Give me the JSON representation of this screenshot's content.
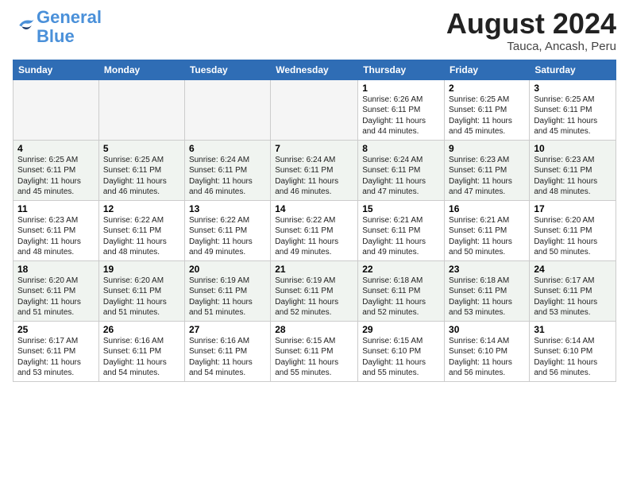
{
  "logo": {
    "line1": "General",
    "line2": "Blue"
  },
  "title": "August 2024",
  "subtitle": "Tauca, Ancash, Peru",
  "days_of_week": [
    "Sunday",
    "Monday",
    "Tuesday",
    "Wednesday",
    "Thursday",
    "Friday",
    "Saturday"
  ],
  "weeks": [
    {
      "cells": [
        {
          "empty": true
        },
        {
          "empty": true
        },
        {
          "empty": true
        },
        {
          "empty": true
        },
        {
          "day": "1",
          "sunrise": "6:26 AM",
          "sunset": "6:11 PM",
          "daylight": "11 hours and 44 minutes."
        },
        {
          "day": "2",
          "sunrise": "6:25 AM",
          "sunset": "6:11 PM",
          "daylight": "11 hours and 45 minutes."
        },
        {
          "day": "3",
          "sunrise": "6:25 AM",
          "sunset": "6:11 PM",
          "daylight": "11 hours and 45 minutes."
        }
      ]
    },
    {
      "cells": [
        {
          "day": "4",
          "sunrise": "6:25 AM",
          "sunset": "6:11 PM",
          "daylight": "11 hours and 45 minutes."
        },
        {
          "day": "5",
          "sunrise": "6:25 AM",
          "sunset": "6:11 PM",
          "daylight": "11 hours and 46 minutes."
        },
        {
          "day": "6",
          "sunrise": "6:24 AM",
          "sunset": "6:11 PM",
          "daylight": "11 hours and 46 minutes."
        },
        {
          "day": "7",
          "sunrise": "6:24 AM",
          "sunset": "6:11 PM",
          "daylight": "11 hours and 46 minutes."
        },
        {
          "day": "8",
          "sunrise": "6:24 AM",
          "sunset": "6:11 PM",
          "daylight": "11 hours and 47 minutes."
        },
        {
          "day": "9",
          "sunrise": "6:23 AM",
          "sunset": "6:11 PM",
          "daylight": "11 hours and 47 minutes."
        },
        {
          "day": "10",
          "sunrise": "6:23 AM",
          "sunset": "6:11 PM",
          "daylight": "11 hours and 48 minutes."
        }
      ]
    },
    {
      "cells": [
        {
          "day": "11",
          "sunrise": "6:23 AM",
          "sunset": "6:11 PM",
          "daylight": "11 hours and 48 minutes."
        },
        {
          "day": "12",
          "sunrise": "6:22 AM",
          "sunset": "6:11 PM",
          "daylight": "11 hours and 48 minutes."
        },
        {
          "day": "13",
          "sunrise": "6:22 AM",
          "sunset": "6:11 PM",
          "daylight": "11 hours and 49 minutes."
        },
        {
          "day": "14",
          "sunrise": "6:22 AM",
          "sunset": "6:11 PM",
          "daylight": "11 hours and 49 minutes."
        },
        {
          "day": "15",
          "sunrise": "6:21 AM",
          "sunset": "6:11 PM",
          "daylight": "11 hours and 49 minutes."
        },
        {
          "day": "16",
          "sunrise": "6:21 AM",
          "sunset": "6:11 PM",
          "daylight": "11 hours and 50 minutes."
        },
        {
          "day": "17",
          "sunrise": "6:20 AM",
          "sunset": "6:11 PM",
          "daylight": "11 hours and 50 minutes."
        }
      ]
    },
    {
      "cells": [
        {
          "day": "18",
          "sunrise": "6:20 AM",
          "sunset": "6:11 PM",
          "daylight": "11 hours and 51 minutes."
        },
        {
          "day": "19",
          "sunrise": "6:20 AM",
          "sunset": "6:11 PM",
          "daylight": "11 hours and 51 minutes."
        },
        {
          "day": "20",
          "sunrise": "6:19 AM",
          "sunset": "6:11 PM",
          "daylight": "11 hours and 51 minutes."
        },
        {
          "day": "21",
          "sunrise": "6:19 AM",
          "sunset": "6:11 PM",
          "daylight": "11 hours and 52 minutes."
        },
        {
          "day": "22",
          "sunrise": "6:18 AM",
          "sunset": "6:11 PM",
          "daylight": "11 hours and 52 minutes."
        },
        {
          "day": "23",
          "sunrise": "6:18 AM",
          "sunset": "6:11 PM",
          "daylight": "11 hours and 53 minutes."
        },
        {
          "day": "24",
          "sunrise": "6:17 AM",
          "sunset": "6:11 PM",
          "daylight": "11 hours and 53 minutes."
        }
      ]
    },
    {
      "cells": [
        {
          "day": "25",
          "sunrise": "6:17 AM",
          "sunset": "6:11 PM",
          "daylight": "11 hours and 53 minutes."
        },
        {
          "day": "26",
          "sunrise": "6:16 AM",
          "sunset": "6:11 PM",
          "daylight": "11 hours and 54 minutes."
        },
        {
          "day": "27",
          "sunrise": "6:16 AM",
          "sunset": "6:11 PM",
          "daylight": "11 hours and 54 minutes."
        },
        {
          "day": "28",
          "sunrise": "6:15 AM",
          "sunset": "6:11 PM",
          "daylight": "11 hours and 55 minutes."
        },
        {
          "day": "29",
          "sunrise": "6:15 AM",
          "sunset": "6:10 PM",
          "daylight": "11 hours and 55 minutes."
        },
        {
          "day": "30",
          "sunrise": "6:14 AM",
          "sunset": "6:10 PM",
          "daylight": "11 hours and 56 minutes."
        },
        {
          "day": "31",
          "sunrise": "6:14 AM",
          "sunset": "6:10 PM",
          "daylight": "11 hours and 56 minutes."
        }
      ]
    }
  ]
}
